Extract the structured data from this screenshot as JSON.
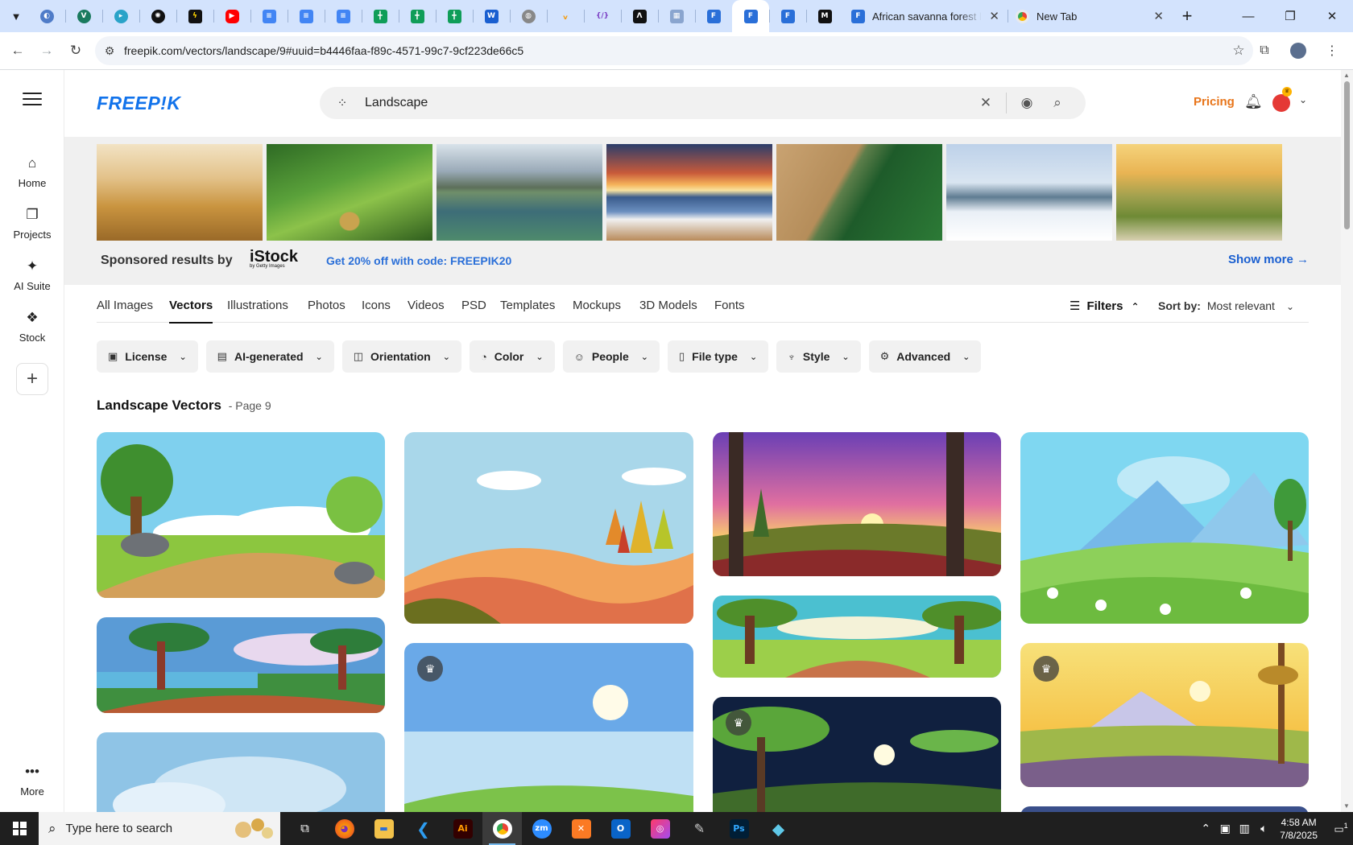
{
  "browser": {
    "tabs": [
      {
        "title": "African savanna forest landscape",
        "close": "✕"
      },
      {
        "title": "New Tab",
        "close": "✕"
      }
    ],
    "new_tab": "+",
    "url": "freepik.com/vectors/landscape/9#uuid=b4446faa-f89c-4571-99c7-9cf223de66c5"
  },
  "sidebar": {
    "items": [
      {
        "label": "Home"
      },
      {
        "label": "Projects"
      },
      {
        "label": "AI Suite"
      },
      {
        "label": "Stock"
      }
    ],
    "more_label": "More"
  },
  "header": {
    "logo": "FREEP!K",
    "search_value": "Landscape",
    "pricing": "Pricing"
  },
  "sponsored": {
    "label": "Sponsored results by",
    "brand": "iStock",
    "brand_sub": "by Getty Images",
    "promo": "Get 20% off with code: FREEPIK20",
    "show_more": "Show more →"
  },
  "content_tabs": [
    {
      "label": "All Images"
    },
    {
      "label": "Vectors"
    },
    {
      "label": "Illustrations"
    },
    {
      "label": "Photos"
    },
    {
      "label": "Icons"
    },
    {
      "label": "Videos"
    },
    {
      "label": "PSD"
    },
    {
      "label": "Templates"
    },
    {
      "label": "Mockups"
    },
    {
      "label": "3D Models"
    },
    {
      "label": "Fonts"
    }
  ],
  "active_tab": "Vectors",
  "filters_label": "Filters",
  "sort": {
    "label": "Sort by:",
    "value": "Most relevant"
  },
  "chips": [
    {
      "label": "License"
    },
    {
      "label": "AI-generated"
    },
    {
      "label": "Orientation"
    },
    {
      "label": "Color"
    },
    {
      "label": "People"
    },
    {
      "label": "File type"
    },
    {
      "label": "Style"
    },
    {
      "label": "Advanced"
    }
  ],
  "results": {
    "title": "Landscape Vectors",
    "page": "- Page 9"
  },
  "taskbar": {
    "search_placeholder": "Type here to search",
    "time": "4:58 AM",
    "date": "7/8/2025",
    "notification_count": "1"
  },
  "colors": {
    "brand": "#1273eb",
    "pricing": "#e8751a",
    "link": "#1a5fd0"
  }
}
